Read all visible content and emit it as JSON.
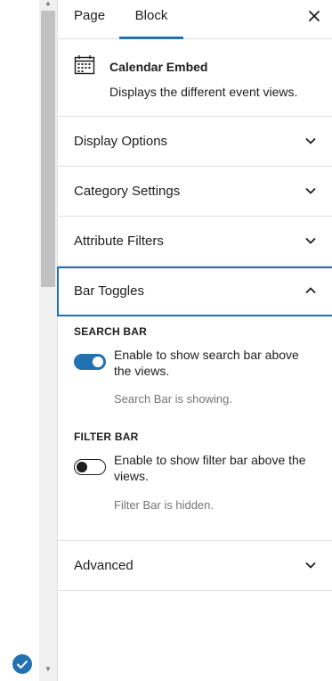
{
  "tabs": {
    "page": "Page",
    "block": "Block"
  },
  "block": {
    "icon": "calendar-icon",
    "title": "Calendar Embed",
    "description": "Displays the different event views."
  },
  "sections": {
    "display_options": "Display Options",
    "category_settings": "Category Settings",
    "attribute_filters": "Attribute Filters",
    "bar_toggles": "Bar Toggles",
    "advanced": "Advanced"
  },
  "bar_toggles": {
    "search_bar": {
      "label": "SEARCH BAR",
      "toggle_text": "Enable to show search bar above the views.",
      "help": "Search Bar is showing.",
      "enabled": true
    },
    "filter_bar": {
      "label": "FILTER BAR",
      "toggle_text": "Enable to show filter bar above the views.",
      "help": "Filter Bar is hidden.",
      "enabled": false
    }
  },
  "colors": {
    "accent": "#2271b1",
    "text": "#1e1e1e",
    "muted": "#757575",
    "border": "#e0e0e0"
  }
}
